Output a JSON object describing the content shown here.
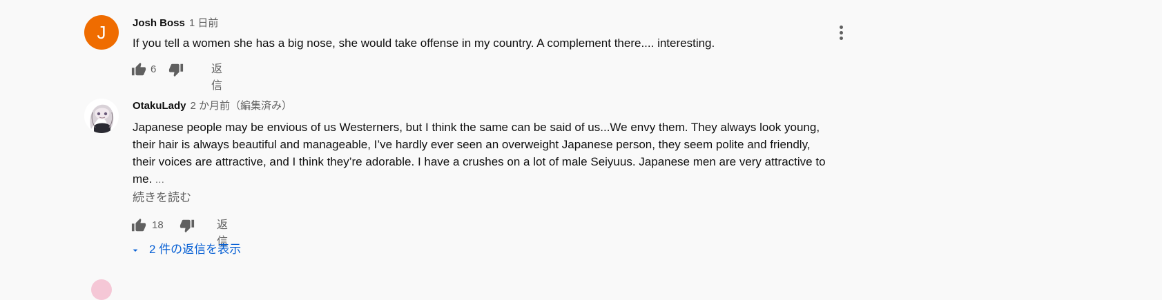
{
  "comments": [
    {
      "avatar_letter": "J",
      "avatar_color": "#ef6c00",
      "author": "Josh Boss",
      "time": "1 日前",
      "text": "If you tell a women she has a big nose, she would take offense in my country. A complement there.... interesting.",
      "like_count": "6",
      "reply_label": "返信"
    },
    {
      "author": "OtakuLady",
      "time": "2 か月前（編集済み）",
      "text": "Japanese people may be envious of us Westerners, but I think the same can be said of us...We envy them. They always look young, their hair is always beautiful and manageable, I’ve hardly ever seen an overweight Japanese person, they seem polite and friendly, their voices are attractive, and I think they’re adorable. I have a crushes on a lot of male Seiyuus. Japanese men are very attractive to me.",
      "ellipsis": "…",
      "read_more": "続きを読む",
      "like_count": "18",
      "reply_label": "返信",
      "view_replies": "2 件の返信を表示"
    }
  ],
  "colors": {
    "background": "#f9f9f9",
    "text_primary": "#0f0f0f",
    "text_secondary": "#606060",
    "link_blue": "#065fd4"
  },
  "icons": [
    "thumbs-up-icon",
    "thumbs-down-icon",
    "more-vert-icon",
    "caret-down-icon"
  ]
}
